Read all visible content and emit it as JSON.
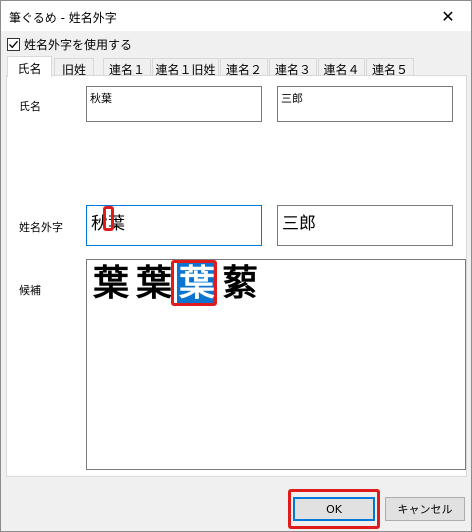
{
  "window": {
    "title": "筆ぐるめ - 姓名外字",
    "close_glyph": "✕"
  },
  "option": {
    "use_gaiji_label": "姓名外字を使用する",
    "checked": true
  },
  "tabs": [
    {
      "label": "氏名",
      "active": true
    },
    {
      "label": "旧姓",
      "active": false
    },
    {
      "label": "連名１",
      "active": false
    },
    {
      "label": "連名１旧姓",
      "active": false
    },
    {
      "label": "連名２",
      "active": false
    },
    {
      "label": "連名３",
      "active": false
    },
    {
      "label": "連名４",
      "active": false
    },
    {
      "label": "連名５",
      "active": false
    }
  ],
  "name_section": {
    "label": "氏名",
    "surname": "秋葉",
    "given_name": "三郎"
  },
  "gaiji_section": {
    "label": "姓名外字",
    "surname": "秋葉",
    "given_name": "三郎"
  },
  "candidates_section": {
    "label": "候補",
    "items": [
      "葉",
      "葉",
      "葉",
      "蕠"
    ],
    "selected_index": 2
  },
  "buttons": {
    "ok": "OK",
    "cancel": "キャンセル"
  },
  "colors": {
    "highlight_red": "#e01b1b",
    "selection_blue": "#0a74d0",
    "focus_blue": "#0078d7"
  }
}
